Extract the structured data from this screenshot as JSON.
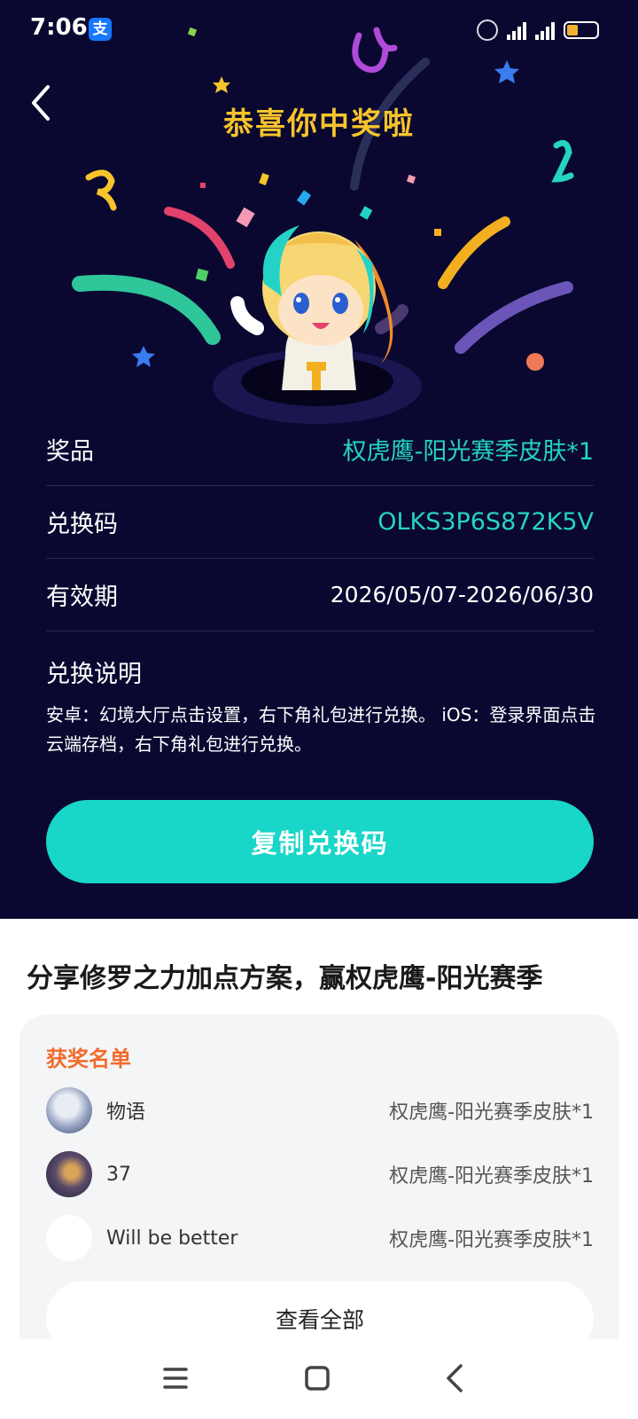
{
  "status_bar": {
    "time": "7:06",
    "alipay_icon": "支",
    "icons": [
      "vibrate-icon",
      "signal-icon",
      "battery-icon"
    ]
  },
  "header": {
    "back_icon": "chevron-left-icon",
    "title": "恭喜你中奖啦"
  },
  "prize_info": {
    "rows": [
      {
        "label": "奖品",
        "value": "权虎鹰-阳光赛季皮肤*1"
      },
      {
        "label": "兑换码",
        "value": "OLKS3P6S872K5V"
      },
      {
        "label": "有效期",
        "value": "2026/05/07-2026/06/30"
      }
    ],
    "instructions_title": "兑换说明",
    "instructions_body": "安卓：幻境大厅点击设置，右下角礼包进行兑换。 iOS：登录界面点击云端存档，右下角礼包进行兑换。",
    "copy_button": "复制兑换码"
  },
  "event": {
    "title": "分享修罗之力加点方案，赢权虎鹰-阳光赛季",
    "winners_title": "获奖名单",
    "winners": [
      {
        "name": "物语",
        "prize": "权虎鹰-阳光赛季皮肤*1"
      },
      {
        "name": "37",
        "prize": "权虎鹰-阳光赛季皮肤*1"
      },
      {
        "name": "Will be better",
        "prize": "权虎鹰-阳光赛季皮肤*1"
      }
    ],
    "view_all": "查看全部"
  },
  "colors": {
    "background": "#0a0830",
    "title_gold": "#f7c42c",
    "accent_teal": "#18d6c8",
    "winners_orange": "#f26b2a"
  }
}
